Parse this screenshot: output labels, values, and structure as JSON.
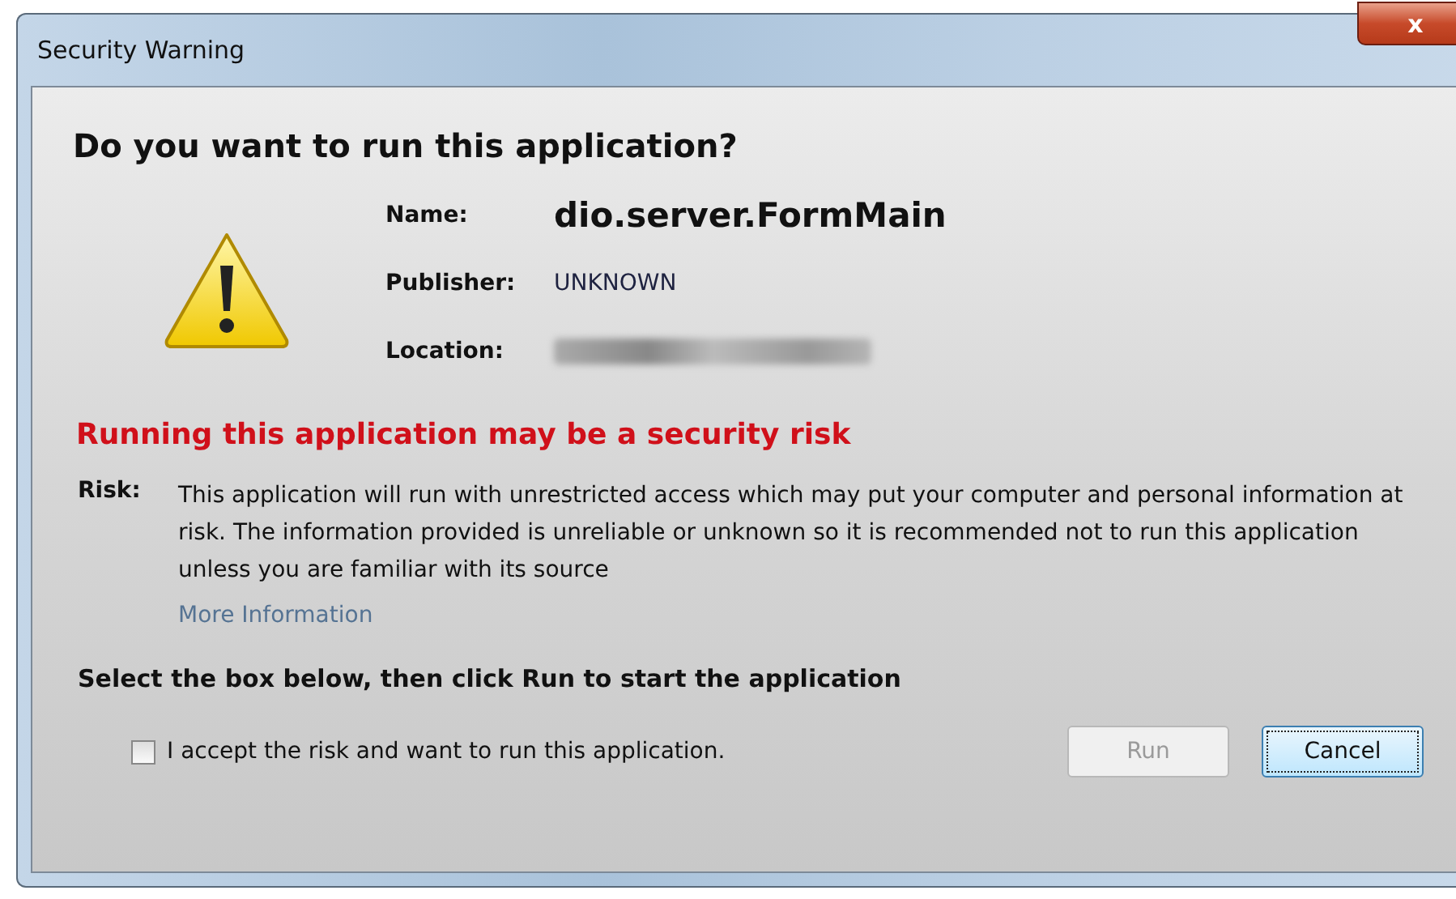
{
  "window": {
    "title": "Security Warning",
    "close": "x"
  },
  "question": "Do you want to run this application?",
  "details": [
    {
      "label": "Name:",
      "value": "dio.server.FormMain",
      "kind": "name"
    },
    {
      "label": "Publisher:",
      "value": "UNKNOWN",
      "kind": "plain"
    },
    {
      "label": "Location:",
      "kind": "blurred"
    }
  ],
  "risk_heading": "Running this application may be a security risk",
  "risk": {
    "label": "Risk:",
    "text": "This application will run with unrestricted access which may put your computer and personal information at risk. The information provided is unreliable or unknown so it is recommended not to run this application unless you are familiar with its source",
    "link": "More Information"
  },
  "instruction": "Select the box below, then click Run to start the application",
  "accept": {
    "label": "I accept the risk and want to run this application.",
    "checked": false
  },
  "buttons": [
    {
      "label": "Run",
      "disabled": true,
      "focused": false
    },
    {
      "label": "Cancel",
      "disabled": false,
      "focused": true
    }
  ]
}
